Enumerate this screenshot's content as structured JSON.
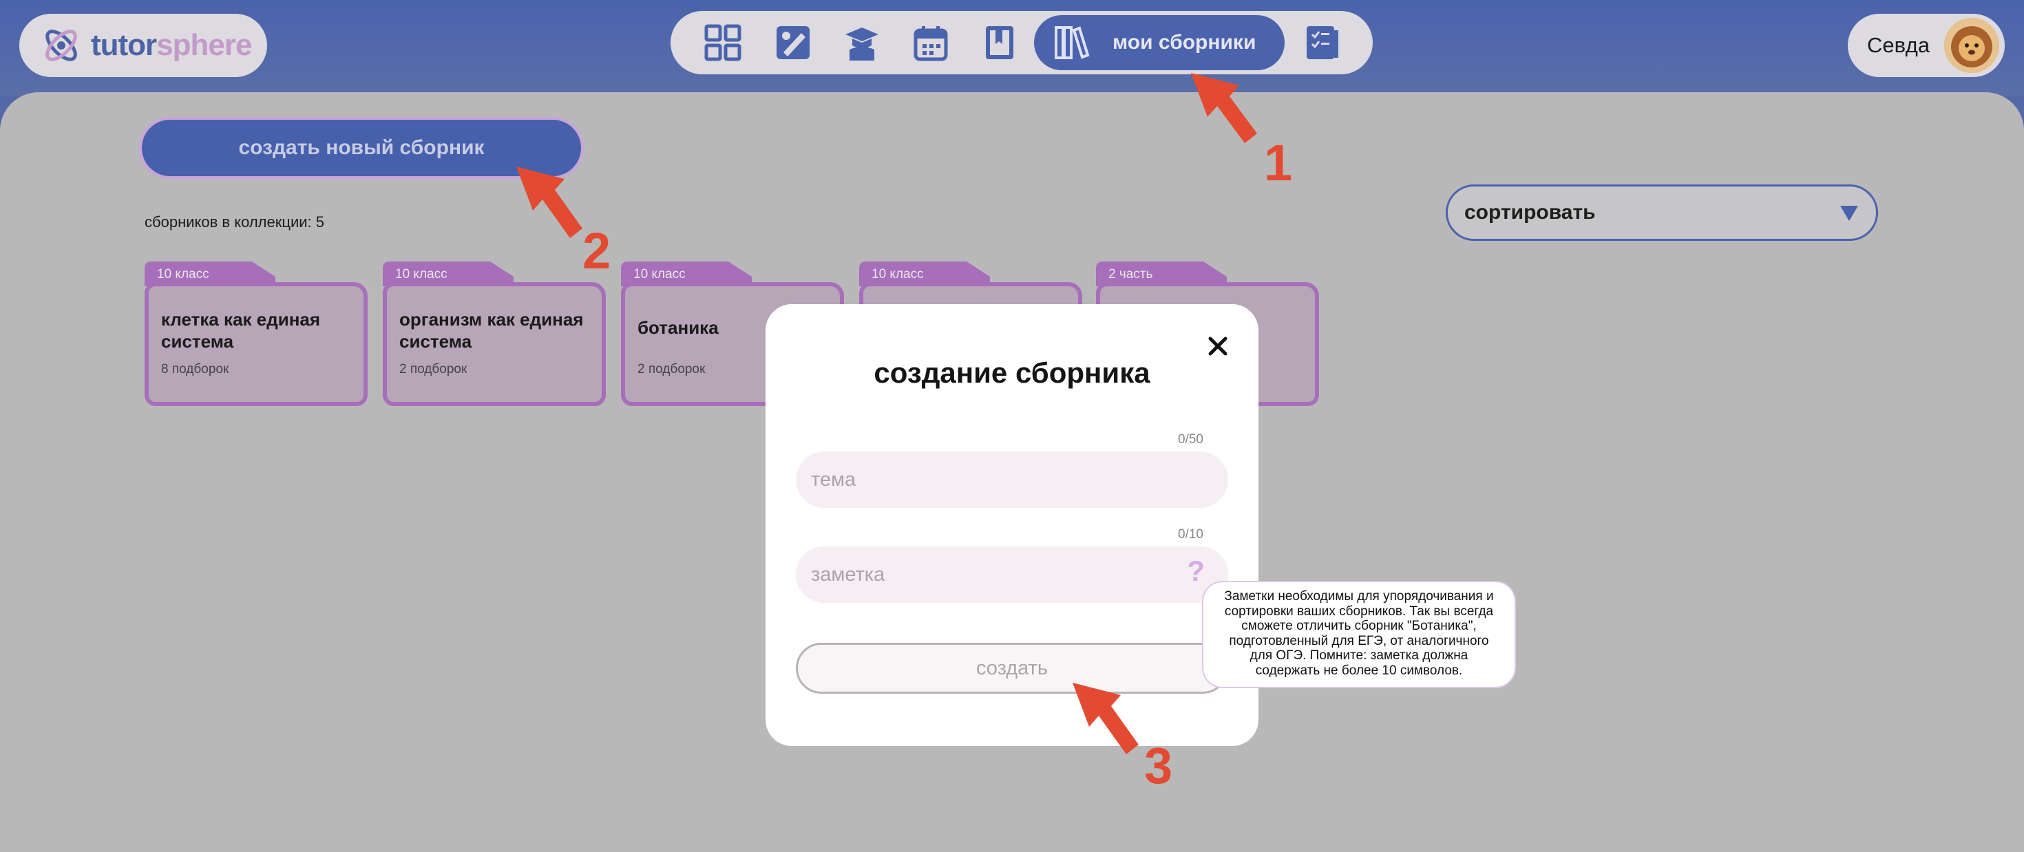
{
  "brand": {
    "part1": "tutor",
    "part2": "sphere"
  },
  "nav": {
    "items": [
      {
        "icon": "dashboard-grid-icon"
      },
      {
        "icon": "canvas-edit-icon"
      },
      {
        "icon": "graduate-icon"
      },
      {
        "icon": "calendar-icon"
      },
      {
        "icon": "book-icon"
      },
      {
        "icon": "library-icon",
        "label": "мои сборники",
        "active": true
      },
      {
        "icon": "checklist-book-icon"
      }
    ]
  },
  "user": {
    "name": "Севда",
    "avatar_icon": "lion-avatar-icon"
  },
  "main": {
    "create_button": "создать новый сборник",
    "count_label": "сборников в коллекции: 5",
    "sort_label": "сортировать"
  },
  "cards": [
    {
      "tag": "10 класс",
      "title": "клетка как единая система",
      "sub": "8 подборок"
    },
    {
      "tag": "10 класс",
      "title": "организм как единая система",
      "sub": "2 подборок"
    },
    {
      "tag": "10 класс",
      "title": "ботаника",
      "sub": "2 подборок"
    },
    {
      "tag": "10 класс",
      "title": "",
      "sub": ""
    },
    {
      "tag": "2 часть",
      "title": "",
      "sub": ""
    }
  ],
  "modal": {
    "title": "создание сборника",
    "topic_counter": "0/50",
    "topic_placeholder": "тема",
    "note_counter": "0/10",
    "note_placeholder": "заметка",
    "help_mark": "?",
    "submit_label": "создать"
  },
  "tooltip": {
    "text": "Заметки необходимы для упорядочивания и сортировки ваших сборников. Так вы всегда сможете отличить сборник \"Ботаника\", подготовленный для ЕГЭ, от аналогичного для ОГЭ. Помните: заметка должна содержать не более 10 символов."
  },
  "annotations": [
    "1",
    "2",
    "3"
  ],
  "colors": {
    "primary": "#4b62ac",
    "folder_border": "#a76eb9",
    "folder_fill": "#b7a5b8",
    "annotation": "#e24b32"
  }
}
